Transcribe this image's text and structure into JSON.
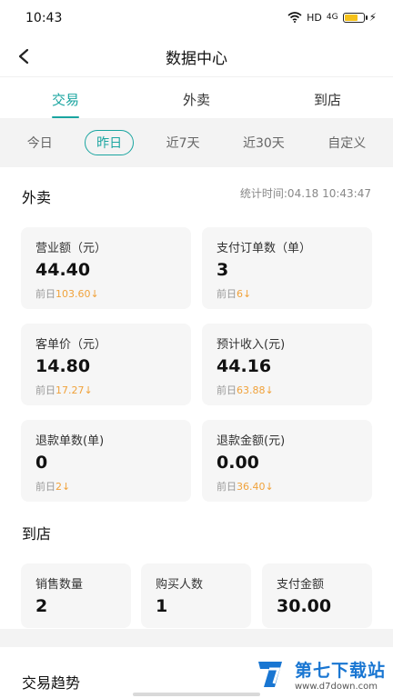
{
  "status_bar": {
    "time": "10:43",
    "network": "HD",
    "signal": "4G"
  },
  "header": {
    "title": "数据中心"
  },
  "tabs": [
    {
      "label": "交易"
    },
    {
      "label": "外卖"
    },
    {
      "label": "到店"
    }
  ],
  "date_ranges": [
    {
      "label": "今日"
    },
    {
      "label": "昨日"
    },
    {
      "label": "近7天"
    },
    {
      "label": "近30天"
    },
    {
      "label": "自定义"
    }
  ],
  "takeout": {
    "title": "外卖",
    "stat_time": "统计时间:04.18 10:43:47",
    "cards": [
      {
        "label": "营业额（元）",
        "value": "44.40",
        "prev_label": "前日",
        "prev_value": "103.60"
      },
      {
        "label": "支付订单数（单）",
        "value": "3",
        "prev_label": "前日",
        "prev_value": "6"
      },
      {
        "label": "客单价（元）",
        "value": "14.80",
        "prev_label": "前日",
        "prev_value": "17.27"
      },
      {
        "label": "预计收入(元)",
        "value": "44.16",
        "prev_label": "前日",
        "prev_value": "63.88"
      },
      {
        "label": "退款单数(单)",
        "value": "0",
        "prev_label": "前日",
        "prev_value": "2"
      },
      {
        "label": "退款金额(元)",
        "value": "0.00",
        "prev_label": "前日",
        "prev_value": "36.40"
      }
    ]
  },
  "instore": {
    "title": "到店",
    "cards": [
      {
        "label": "销售数量",
        "value": "2"
      },
      {
        "label": "购买人数",
        "value": "1"
      },
      {
        "label": "支付金额",
        "value": "30.00"
      }
    ]
  },
  "trend": {
    "title": "交易趋势"
  },
  "watermark": {
    "title": "第七下载站",
    "url": "www.d7down.com"
  },
  "colors": {
    "accent": "#1aa5a0",
    "decrease": "#f0a23b"
  },
  "trend_arrow": "↓"
}
